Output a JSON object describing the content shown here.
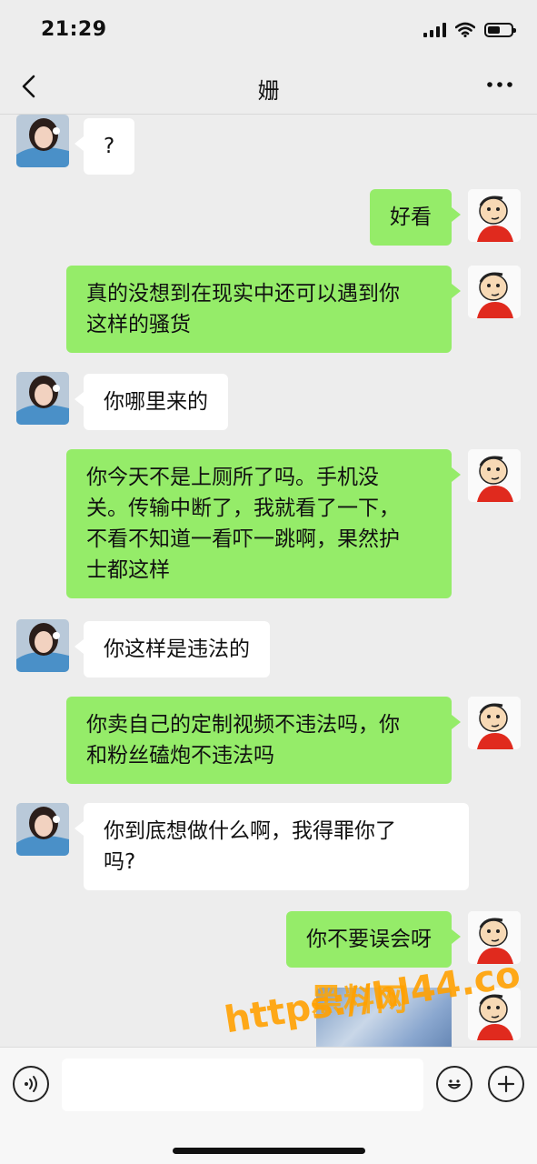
{
  "status": {
    "time": "21:29"
  },
  "nav": {
    "title": "姗",
    "back_icon": "chevron-left-icon",
    "more_icon": "more-dots-icon"
  },
  "messages": [
    {
      "side": "left",
      "text": "?"
    },
    {
      "side": "right",
      "text": "好看"
    },
    {
      "side": "right",
      "text": "真的没想到在现实中还可以遇到你\n这样的骚货"
    },
    {
      "side": "left",
      "text": "你哪里来的"
    },
    {
      "side": "right",
      "text": "你今天不是上厕所了吗。手机没\n关。传输中断了，我就看了一下，\n不看不知道一看吓一跳啊，果然护\n士都这样"
    },
    {
      "side": "left",
      "text": "你这样是违法的"
    },
    {
      "side": "right",
      "text": "你卖自己的定制视频不违法吗，你\n和粉丝磕炮不违法吗"
    },
    {
      "side": "left",
      "text": "你到底想做什么啊，我得罪你了\n吗?"
    },
    {
      "side": "right",
      "text": "你不要误会呀"
    }
  ],
  "input": {
    "placeholder": ""
  },
  "watermark": {
    "top": "黑料网",
    "url": "https://hl44.co"
  },
  "colors": {
    "bg": "#ededed",
    "my_bubble": "#95ec69",
    "their_bubble": "#ffffff",
    "watermark": "#ffa500"
  }
}
